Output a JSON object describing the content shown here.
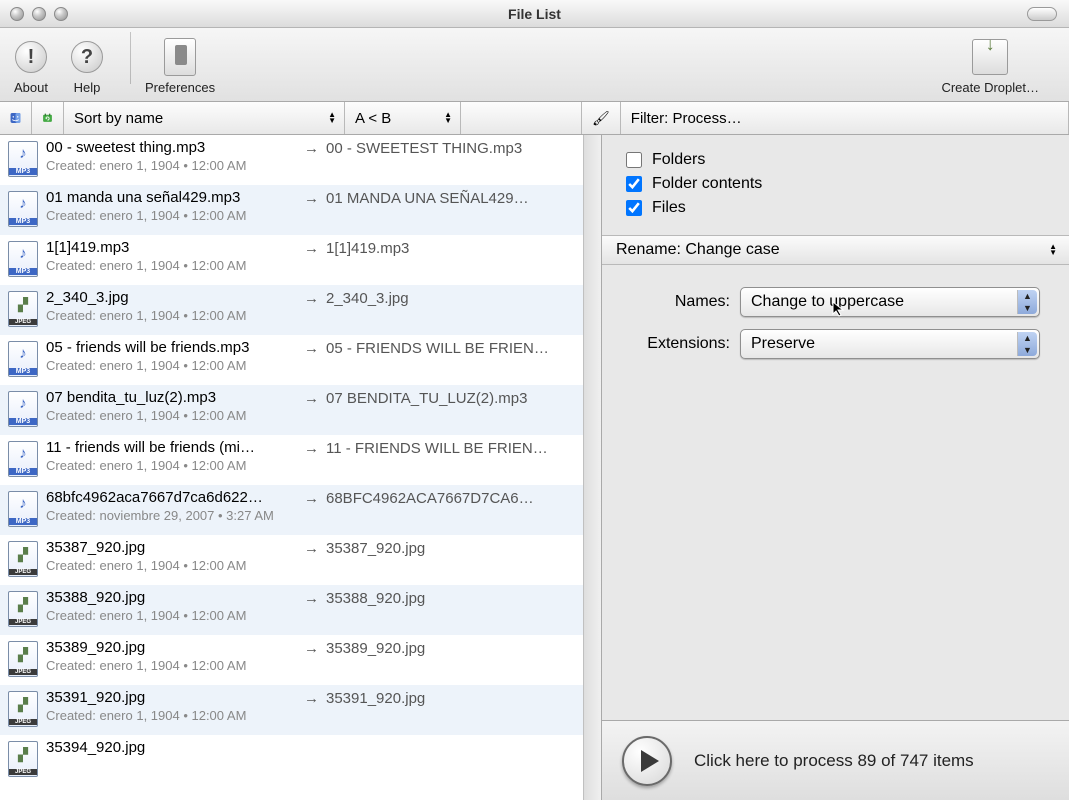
{
  "window": {
    "title": "File List"
  },
  "toolbar": {
    "about": "About",
    "help": "Help",
    "preferences": "Preferences",
    "create_droplet": "Create Droplet…"
  },
  "header": {
    "sort_label": "Sort by name",
    "direction_label": "A < B",
    "filter_label": "Filter: Process…"
  },
  "files": [
    {
      "type": "mp3",
      "name": "00 - sweetest thing.mp3",
      "created": "Created: enero 1, 1904 • 12:00 AM",
      "renamed": "00 - SWEETEST THING.mp3"
    },
    {
      "type": "mp3",
      "name": "01 manda una señal429.mp3",
      "created": "Created: enero 1, 1904 • 12:00 AM",
      "renamed": "01 MANDA UNA SEÑAL429…"
    },
    {
      "type": "mp3",
      "name": "1[1]419.mp3",
      "created": "Created: enero 1, 1904 • 12:00 AM",
      "renamed": "1[1]419.mp3"
    },
    {
      "type": "jpg",
      "name": "2_340_3.jpg",
      "created": "Created: enero 1, 1904 • 12:00 AM",
      "renamed": "2_340_3.jpg"
    },
    {
      "type": "mp3",
      "name": "05 - friends will be friends.mp3",
      "created": "Created: enero 1, 1904 • 12:00 AM",
      "renamed": "05 - FRIENDS WILL BE FRIEN…"
    },
    {
      "type": "mp3",
      "name": "07 bendita_tu_luz(2).mp3",
      "created": "Created: enero 1, 1904 • 12:00 AM",
      "renamed": "07 BENDITA_TU_LUZ(2).mp3"
    },
    {
      "type": "mp3",
      "name": "11 - friends will be friends (mi…",
      "created": "Created: enero 1, 1904 • 12:00 AM",
      "renamed": "11 - FRIENDS WILL BE FRIEN…"
    },
    {
      "type": "mp3",
      "name": "68bfc4962aca7667d7ca6d622…",
      "created": "Created: noviembre 29, 2007 • 3:27 AM",
      "renamed": "68BFC4962ACA7667D7CA6…"
    },
    {
      "type": "jpg",
      "name": "35387_920.jpg",
      "created": "Created: enero 1, 1904 • 12:00 AM",
      "renamed": "35387_920.jpg"
    },
    {
      "type": "jpg",
      "name": "35388_920.jpg",
      "created": "Created: enero 1, 1904 • 12:00 AM",
      "renamed": "35388_920.jpg"
    },
    {
      "type": "jpg",
      "name": "35389_920.jpg",
      "created": "Created: enero 1, 1904 • 12:00 AM",
      "renamed": "35389_920.jpg"
    },
    {
      "type": "jpg",
      "name": "35391_920.jpg",
      "created": "Created: enero 1, 1904 • 12:00 AM",
      "renamed": "35391_920.jpg"
    },
    {
      "type": "jpg",
      "name": "35394_920.jpg",
      "created": "",
      "renamed": ""
    }
  ],
  "filter": {
    "folders": {
      "label": "Folders",
      "checked": false
    },
    "folder_contents": {
      "label": "Folder contents",
      "checked": true
    },
    "files": {
      "label": "Files",
      "checked": true
    }
  },
  "rename_section": {
    "title": "Rename: Change case",
    "names_label": "Names:",
    "names_value": "Change to uppercase",
    "extensions_label": "Extensions:",
    "extensions_value": "Preserve"
  },
  "process": {
    "label": "Click here to process 89 of 747 items"
  }
}
